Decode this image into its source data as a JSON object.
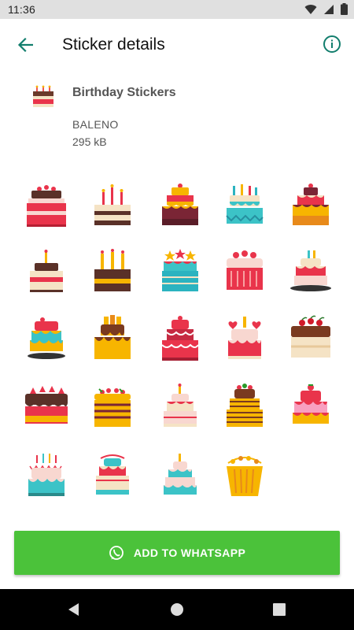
{
  "status_bar": {
    "time": "11:36"
  },
  "app_bar": {
    "title": "Sticker details"
  },
  "pack": {
    "name": "Birthday Stickers",
    "publisher": "BALENO",
    "size": "295 kB"
  },
  "stickers": [
    "cake-red-stripes",
    "cake-three-candles",
    "cake-tiered-cherry",
    "cake-teal-candles",
    "cake-tiered-orange",
    "cake-small-candle",
    "cake-chocolate-candles",
    "cake-teal-stars",
    "cake-cherry-red",
    "cake-berry-tray",
    "cake-drip-blue",
    "cake-drip-orange",
    "cake-tiered-pink",
    "cake-hearts",
    "cake-cherries-top",
    "cake-strawberries",
    "cake-berry-orange",
    "cake-tiered-cream",
    "cake-orange-layers",
    "cake-strawberry-pink",
    "cake-pastel-bunting",
    "cake-teal-red-tiers",
    "cake-pastel-tiers",
    "cake-cupcake-orange"
  ],
  "cta": {
    "label": "ADD TO WHATSAPP"
  }
}
